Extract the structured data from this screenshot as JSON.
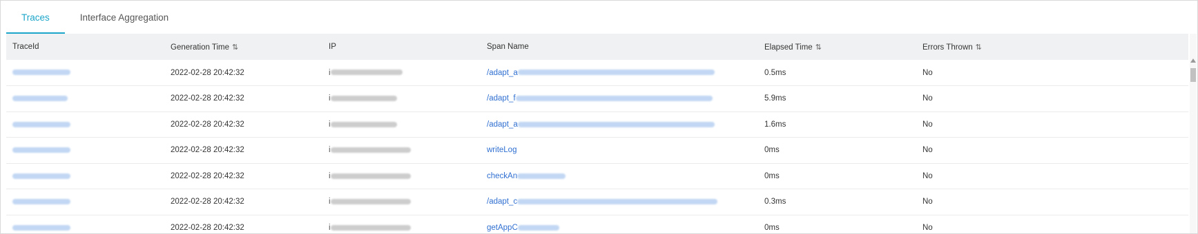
{
  "tabs": [
    {
      "label": "Traces",
      "active": true
    },
    {
      "label": "Interface Aggregation",
      "active": false
    }
  ],
  "accent_color": "#1aa5c9",
  "link_color": "#2f6fd1",
  "columns": [
    {
      "label": "TraceId",
      "sortable": false
    },
    {
      "label": "Generation Time",
      "sortable": true
    },
    {
      "label": "IP",
      "sortable": false
    },
    {
      "label": "Span Name",
      "sortable": false
    },
    {
      "label": "Elapsed Time",
      "sortable": true
    },
    {
      "label": "Errors Thrown",
      "sortable": true
    }
  ],
  "sort_glyph": "⇅",
  "rows": [
    {
      "time": "2022-02-28 20:42:32",
      "ip_prefix": "i",
      "span": "/adapt_a",
      "elapsed": "0.5ms",
      "errors": "No"
    },
    {
      "time": "2022-02-28 20:42:32",
      "ip_prefix": "i",
      "span": "/adapt_f",
      "elapsed": "5.9ms",
      "errors": "No"
    },
    {
      "time": "2022-02-28 20:42:32",
      "ip_prefix": "i",
      "span": "/adapt_a",
      "elapsed": "1.6ms",
      "errors": "No"
    },
    {
      "time": "2022-02-28 20:42:32",
      "ip_prefix": "i",
      "span": "writeLog",
      "elapsed": "0ms",
      "errors": "No"
    },
    {
      "time": "2022-02-28 20:42:32",
      "ip_prefix": "i",
      "span": "checkAn",
      "elapsed": "0ms",
      "errors": "No"
    },
    {
      "time": "2022-02-28 20:42:32",
      "ip_prefix": "i",
      "span": "/adapt_c",
      "elapsed": "0.3ms",
      "errors": "No"
    },
    {
      "time": "2022-02-28 20:42:32",
      "ip_prefix": "i",
      "span": "getAppC",
      "elapsed": "0ms",
      "errors": "No"
    }
  ]
}
